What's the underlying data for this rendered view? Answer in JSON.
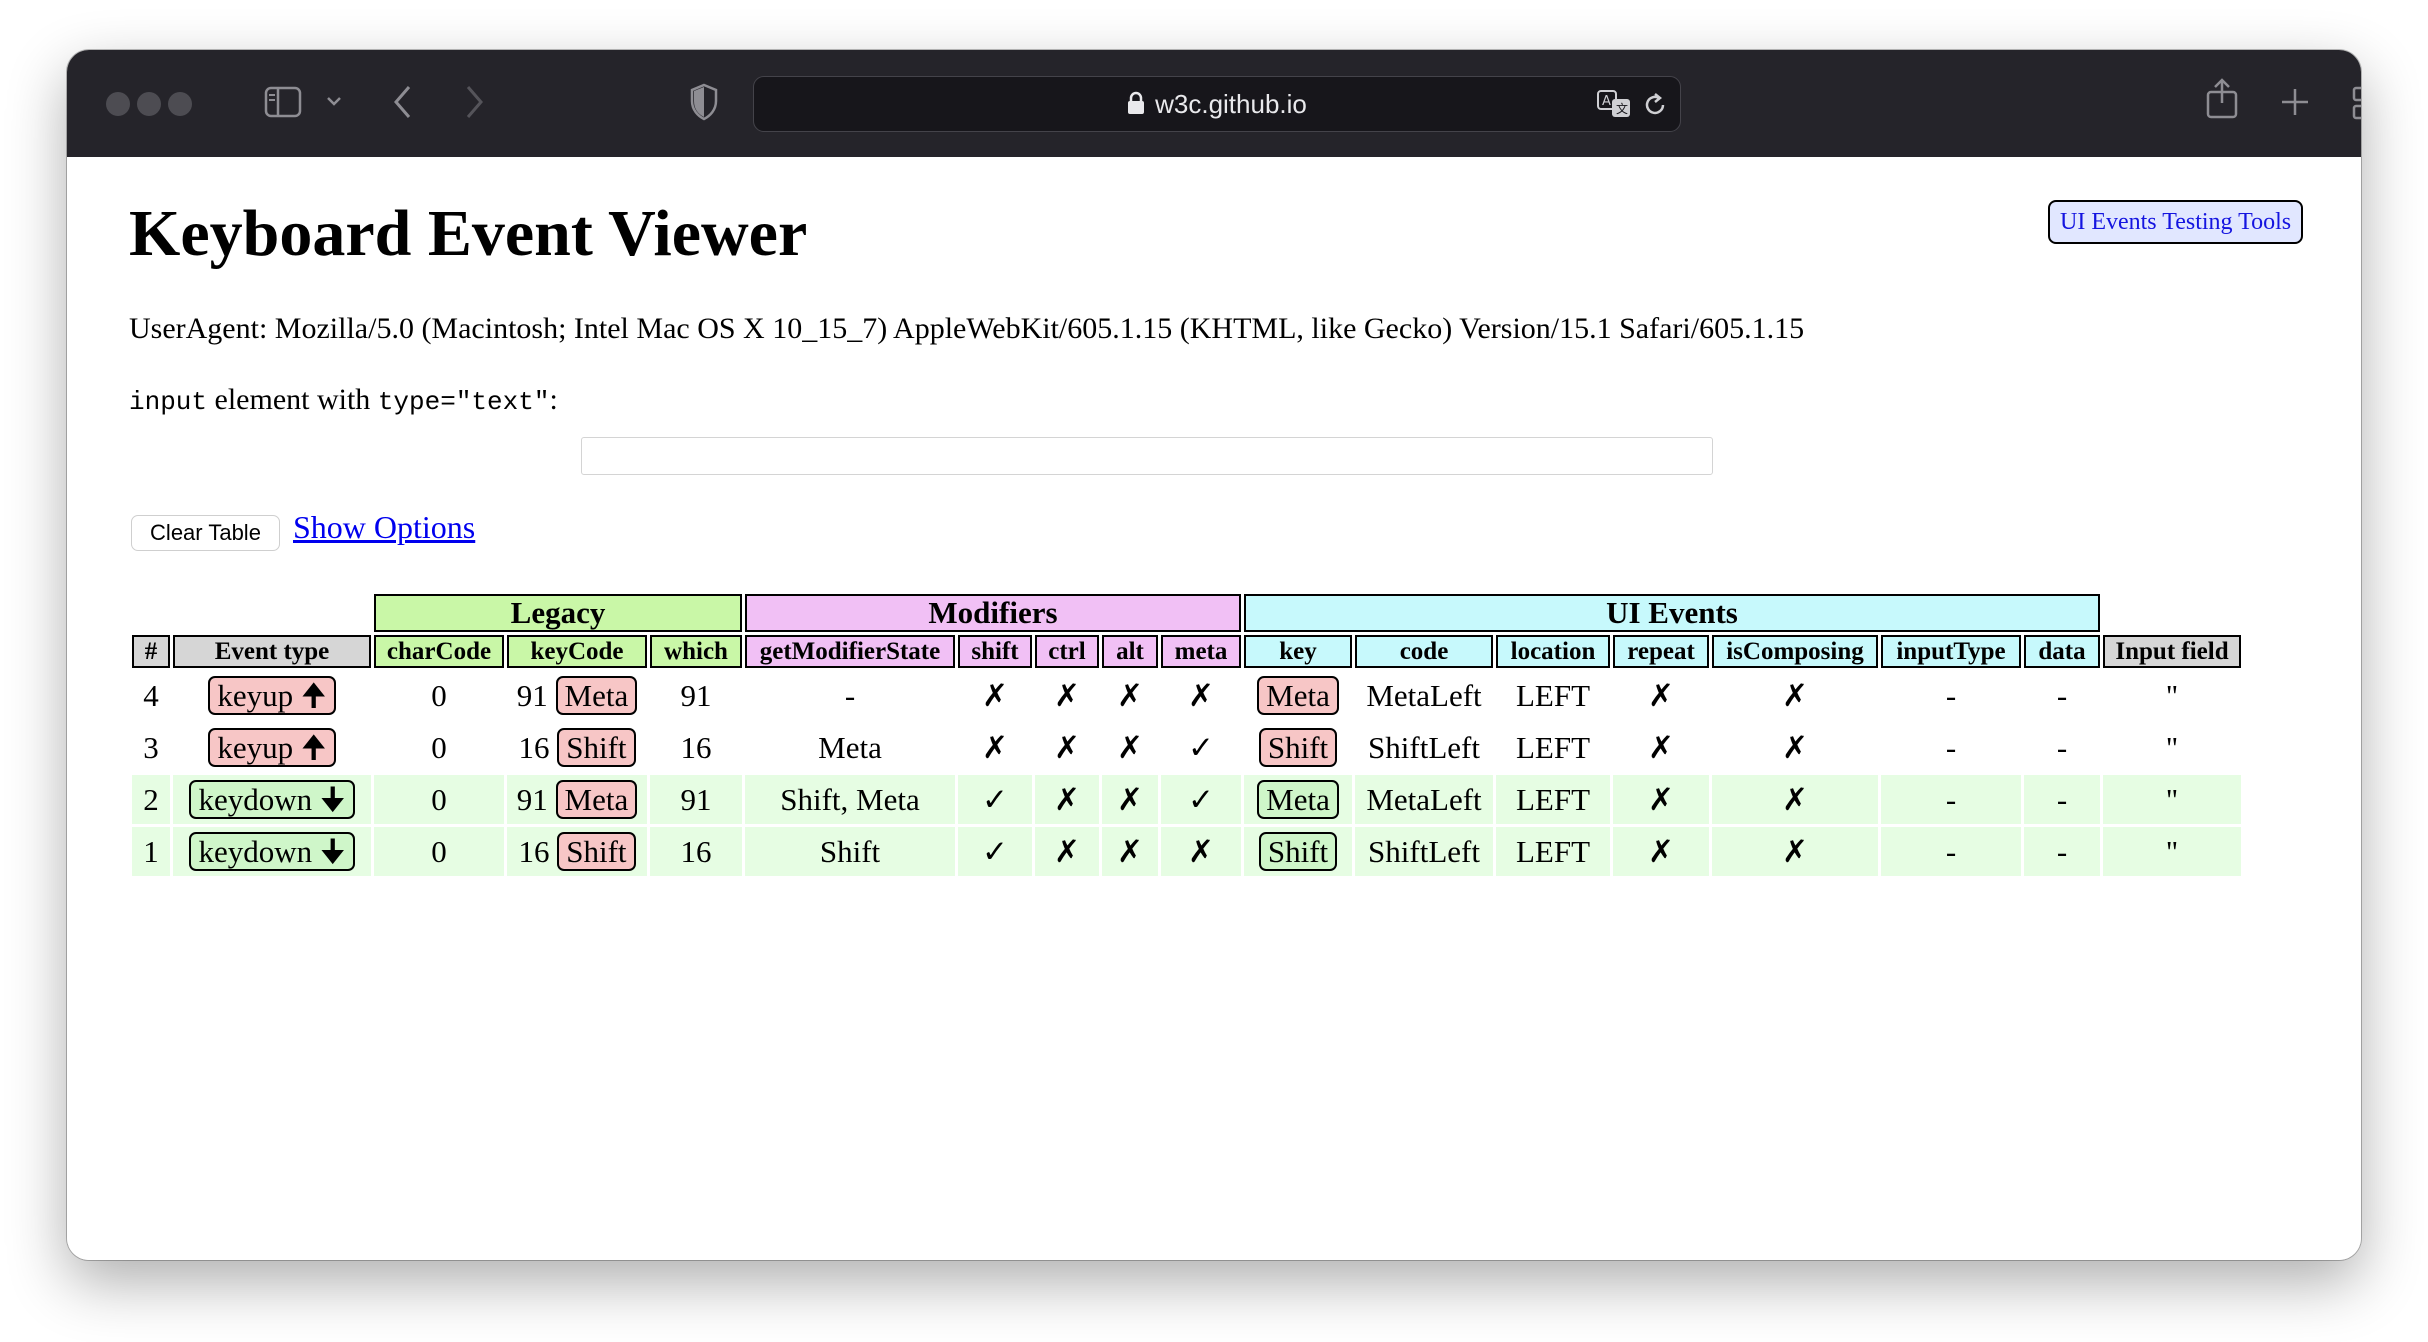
{
  "browser": {
    "url": "w3c.github.io",
    "icons": [
      "sidebar-icon",
      "chevron-down-icon",
      "back-icon",
      "forward-icon",
      "shield-icon",
      "lock-icon",
      "translate-icon",
      "reload-icon",
      "share-icon",
      "new-tab-icon",
      "tab-overview-icon"
    ]
  },
  "page": {
    "title": "Keyboard Event Viewer",
    "tools_link": "UI Events Testing Tools",
    "useragent": "UserAgent: Mozilla/5.0 (Macintosh; Intel Mac OS X 10_15_7) AppleWebKit/605.1.15 (KHTML, like Gecko) Version/15.1 Safari/605.1.15",
    "input_label": {
      "code1": "input",
      "text": " element with ",
      "code2": "type=\"text\"",
      "colon": ":"
    },
    "input_value": "",
    "clear_button": "Clear Table",
    "show_options": "Show Options"
  },
  "table": {
    "groups": {
      "legacy": "Legacy",
      "modifiers": "Modifiers",
      "ui_events": "UI Events"
    },
    "headers": [
      "#",
      "Event type",
      "charCode",
      "keyCode",
      "which",
      "getModifierState",
      "shift",
      "ctrl",
      "alt",
      "meta",
      "key",
      "code",
      "location",
      "repeat",
      "isComposing",
      "inputType",
      "data",
      "Input field"
    ],
    "rows": [
      {
        "num": "4",
        "type": "keyup",
        "arrow": "🠉",
        "charCode": "0",
        "keyCode": "91",
        "keyName": "Meta",
        "which": "91",
        "modState": "-",
        "shift": "✗",
        "ctrl": "✗",
        "alt": "✗",
        "meta": "✗",
        "key": "Meta",
        "code": "MetaLeft",
        "location": "LEFT",
        "repeat": "✗",
        "isComposing": "✗",
        "inputType": "-",
        "data": "-",
        "inputField": "''"
      },
      {
        "num": "3",
        "type": "keyup",
        "arrow": "🠉",
        "charCode": "0",
        "keyCode": "16",
        "keyName": "Shift",
        "which": "16",
        "modState": "Meta",
        "shift": "✗",
        "ctrl": "✗",
        "alt": "✗",
        "meta": "✓",
        "key": "Shift",
        "code": "ShiftLeft",
        "location": "LEFT",
        "repeat": "✗",
        "isComposing": "✗",
        "inputType": "-",
        "data": "-",
        "inputField": "''"
      },
      {
        "num": "2",
        "type": "keydown",
        "arrow": "🠋",
        "charCode": "0",
        "keyCode": "91",
        "keyName": "Meta",
        "which": "91",
        "modState": "Shift, Meta",
        "shift": "✓",
        "ctrl": "✗",
        "alt": "✗",
        "meta": "✓",
        "key": "Meta",
        "code": "MetaLeft",
        "location": "LEFT",
        "repeat": "✗",
        "isComposing": "✗",
        "inputType": "-",
        "data": "-",
        "inputField": "''"
      },
      {
        "num": "1",
        "type": "keydown",
        "arrow": "🠋",
        "charCode": "0",
        "keyCode": "16",
        "keyName": "Shift",
        "which": "16",
        "modState": "Shift",
        "shift": "✓",
        "ctrl": "✗",
        "alt": "✗",
        "meta": "✗",
        "key": "Shift",
        "code": "ShiftLeft",
        "location": "LEFT",
        "repeat": "✗",
        "isComposing": "✗",
        "inputType": "-",
        "data": "-",
        "inputField": "''"
      }
    ]
  },
  "colors": {
    "legacy": "#c9f7a7",
    "modifiers": "#f1c0f5",
    "ui_events": "#c7f9fc",
    "keyup": "#f7c6c6",
    "keydown": "#cff6c9",
    "down_row": "#e6fde3",
    "check": "#1c8a1c",
    "cross": "#f4b2b2"
  }
}
